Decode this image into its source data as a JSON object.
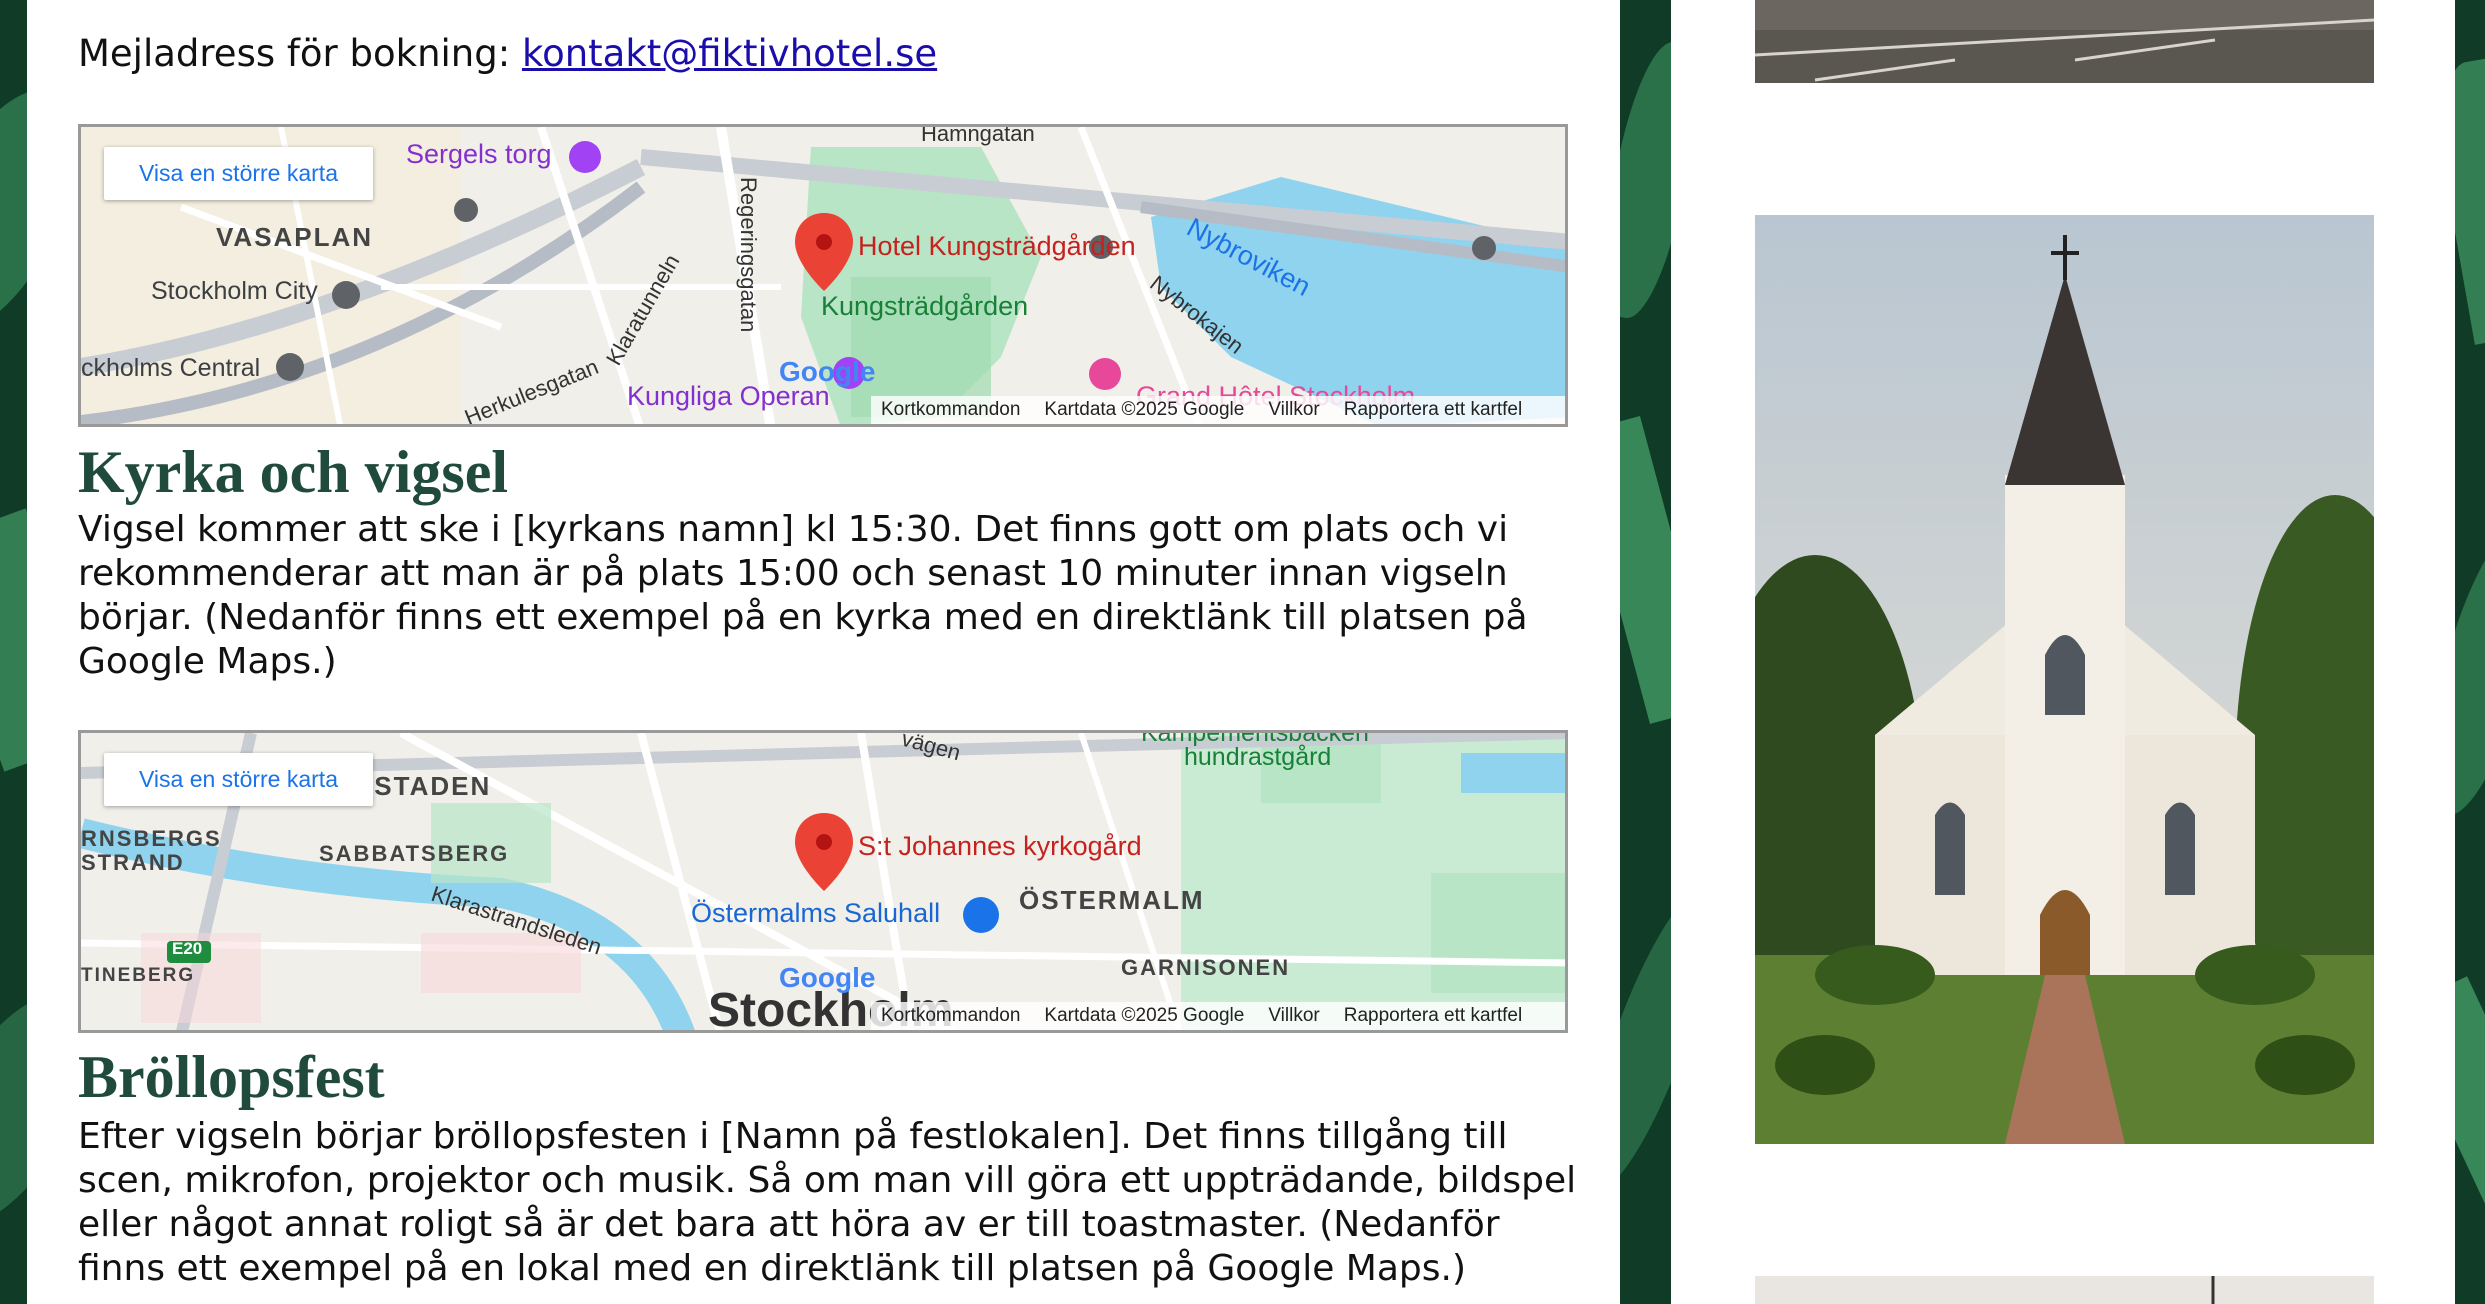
{
  "booking": {
    "label": "Mejladress för bokning:",
    "email": "kontakt@fiktivhotel.se"
  },
  "map1": {
    "button": "Visa en större karta",
    "marker_label": "Hotel Kungsträdgården",
    "labels": {
      "sergels": "Sergels torg",
      "vasaplan": "VASAPLAN",
      "stockholm_city": "Stockholm City",
      "central": "ckholms Central",
      "kungstradgarden": "Kungsträdgården",
      "nybroviken": "Nybroviken",
      "nybrokajen": "Nybrokajen",
      "operan": "Kungliga Operan",
      "grand": "Grand Hôtel Stockholm",
      "regeringsgatan": "Regeringsgatan",
      "klaratunneln": "Klaratunneln",
      "herkulesgatan": "Herkulesgatan",
      "hamngatan": "Hamngatan"
    },
    "footer": [
      "Kortkommandon",
      "Kartdata ©2025 Google",
      "Villkor",
      "Rapportera ett kartfel"
    ],
    "logo": "Google"
  },
  "church": {
    "title": "Kyrka och vigsel",
    "text": "Vigsel kommer att ske i [kyrkans namn] kl 15:30. Det finns gott om plats och vi rekommenderar att man är på plats 15:00 och senast 10 minuter innan vigseln börjar. (Nedanför finns ett exempel på en kyrka med en direktlänk till platsen på Google Maps.)"
  },
  "map2": {
    "button": "Visa en större karta",
    "marker_label": "S:t Johannes kyrkogård",
    "labels": {
      "vasastaden": "VASASTADEN",
      "sabbatsberg": "SABBATSBERG",
      "rnsbergs": "RNSBERGS",
      "strand": "STRAND",
      "tineberg": "TINEBERG",
      "klarastrand": "Klarastrandsleden",
      "saluhall": "Östermalms Saluhall",
      "ostermalm": "ÖSTERMALM",
      "garnisonen": "GARNISONEN",
      "hundrastgard": "hundrastgård",
      "kampement": "Kampementsbacken",
      "stockholm": "Stockholm",
      "e20": "E20",
      "vagen": "vägen"
    },
    "footer": [
      "Kortkommandon",
      "Kartdata ©2025 Google",
      "Villkor",
      "Rapportera ett kartfel"
    ],
    "logo": "Google"
  },
  "party": {
    "title": "Bröllopsfest",
    "text": "Efter vigseln börjar bröllopsfesten i [Namn på festlokalen]. Det finns tillgång till scen, mikrofon, projektor och musik. Så om man vill göra ett uppträdande, bildspel eller något annat roligt så är det bara att höra av er till toastmaster. (Nedanför finns ett exempel på en lokal med en direktlänk till platsen på Google Maps.)"
  },
  "colors": {
    "heading": "#1f4a3c",
    "link": "#1a0dab",
    "marker": "#ea4335",
    "water": "#8fd3ee"
  }
}
